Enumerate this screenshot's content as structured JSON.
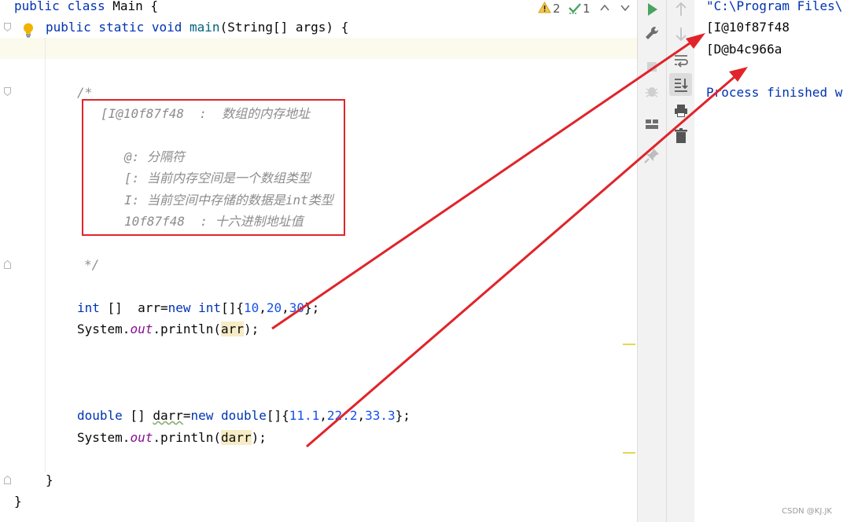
{
  "editor": {
    "line_class": [
      "public class Main {"
    ],
    "line_main": {
      "mod": "public static void ",
      "name": "main",
      "rest": "(String[] args) {"
    },
    "comment": {
      "open": "/*",
      "l1": "[I@10f87f48  :  数组的内存地址",
      "l2": "@: 分隔符",
      "l3": "[: 当前内存空间是一个数组类型",
      "l4": "I: 当前空间中存储的数据是int类型",
      "l5": "10f87f48  : 十六进制地址值",
      "close": "*/"
    },
    "int_line": {
      "t1": "int",
      "t2": " []  arr=",
      "t3": "new",
      "t4": " ",
      "t5": "int",
      "t6": "[]{",
      "n1": "10",
      "c1": ",",
      "n2": "20",
      "c2": ",",
      "n3": "30",
      "t7": "};"
    },
    "print1": {
      "p1": "System.",
      "p2": "out",
      "p3": ".println(",
      "p4": "arr",
      "p5": ");"
    },
    "double_line": {
      "t1": "double",
      "t2": " [] ",
      "t3": "darr",
      "t4": "=",
      "t5": "new",
      "t6": " ",
      "t7": "double",
      "t8": "[]{",
      "n1": "11.1",
      "c1": ",",
      "n2": "22.2",
      "c2": ",",
      "n3": "33.3",
      "t9": "};"
    },
    "print2": {
      "p1": "System.",
      "p2": "out",
      "p3": ".println(",
      "p4": "darr",
      "p5": ");"
    },
    "close_inner": "}",
    "close_outer": "}"
  },
  "inspections": {
    "warnings": "2",
    "weak_warnings": "1"
  },
  "console": {
    "lines": [
      "\"C:\\Program Files\\",
      "[I@10f87f48",
      "[D@b4c966a",
      "",
      "Process finished w"
    ]
  },
  "watermark": "CSDN @KJ.JK",
  "colors": {
    "keyword": "#0033b3",
    "number": "#1750eb",
    "static_field": "#871094",
    "comment": "#8c8c8c",
    "annotation_red": "#e0242a"
  }
}
